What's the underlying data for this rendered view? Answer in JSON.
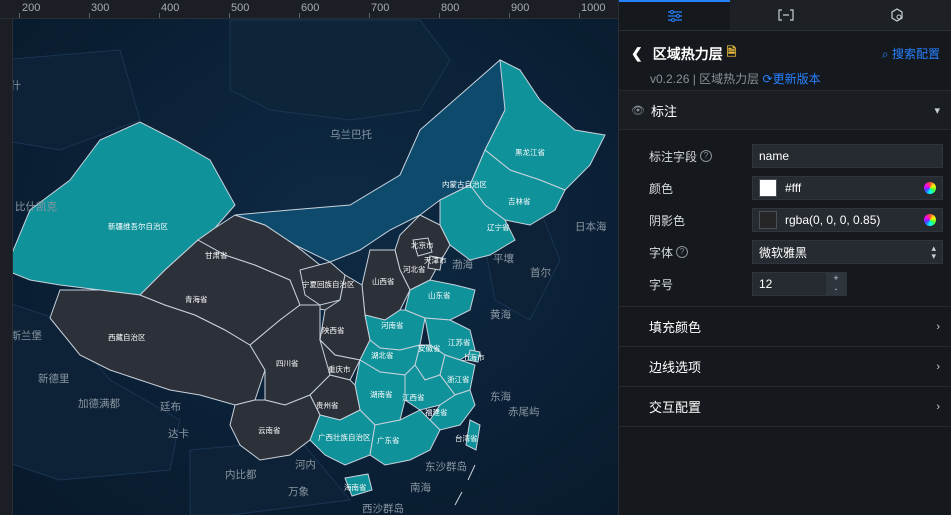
{
  "ruler": {
    "ticks": [
      "200",
      "300",
      "400",
      "500",
      "600",
      "700",
      "800",
      "900",
      "1000"
    ]
  },
  "map": {
    "background_labels": [
      "塔什",
      "乌兰巴托",
      "比什凯克",
      "伊斯兰堡",
      "新德里",
      "加德满都",
      "廷布",
      "达卡",
      "内比都",
      "河内",
      "万象",
      "平壤",
      "首尔",
      "南海",
      "东海",
      "黄海",
      "渤海",
      "日本海",
      "赤尾屿",
      "东沙群岛",
      "西沙群岛"
    ],
    "provinces": [
      "新疆维吾尔自治区",
      "西藏自治区",
      "青海省",
      "甘肃省",
      "内蒙古自治区",
      "黑龙江省",
      "吉林省",
      "辽宁省",
      "北京市",
      "天津市",
      "河北省",
      "山西省",
      "宁夏回族自治区",
      "陕西省",
      "山东省",
      "河南省",
      "江苏省",
      "上海市",
      "安徽省",
      "湖北省",
      "四川省",
      "重庆市",
      "浙江省",
      "江西省",
      "湖南省",
      "贵州省",
      "云南省",
      "福建省",
      "广西壮族自治区",
      "广东省",
      "台湾省",
      "海南省"
    ],
    "colors": {
      "teal": "#10929a",
      "teal_light": "#1a9aa3",
      "navy": "#0d4a6b",
      "dark": "#2c3038",
      "border": "#c8d2dc"
    }
  },
  "panel": {
    "tabs": [
      {
        "name": "style",
        "icon": "sliders-icon"
      },
      {
        "name": "data",
        "icon": "bracket-icon"
      },
      {
        "name": "interaction",
        "icon": "refresh-icon"
      }
    ],
    "title": "区域热力层",
    "search_label": "搜索配置",
    "version": "v0.2.26 | 区域热力层",
    "update_label": "更新版本",
    "label_section": "标注",
    "fields": {
      "field_label": "标注字段",
      "field_value": "name",
      "color_label": "颜色",
      "color_value": "#fff",
      "shadow_label": "阴影色",
      "shadow_value": "rgba(0, 0, 0, 0.85)",
      "font_label": "字体",
      "font_value": "微软雅黑",
      "size_label": "字号",
      "size_value": "12"
    },
    "collapsed_sections": [
      "填充颜色",
      "边线选项",
      "交互配置"
    ]
  }
}
